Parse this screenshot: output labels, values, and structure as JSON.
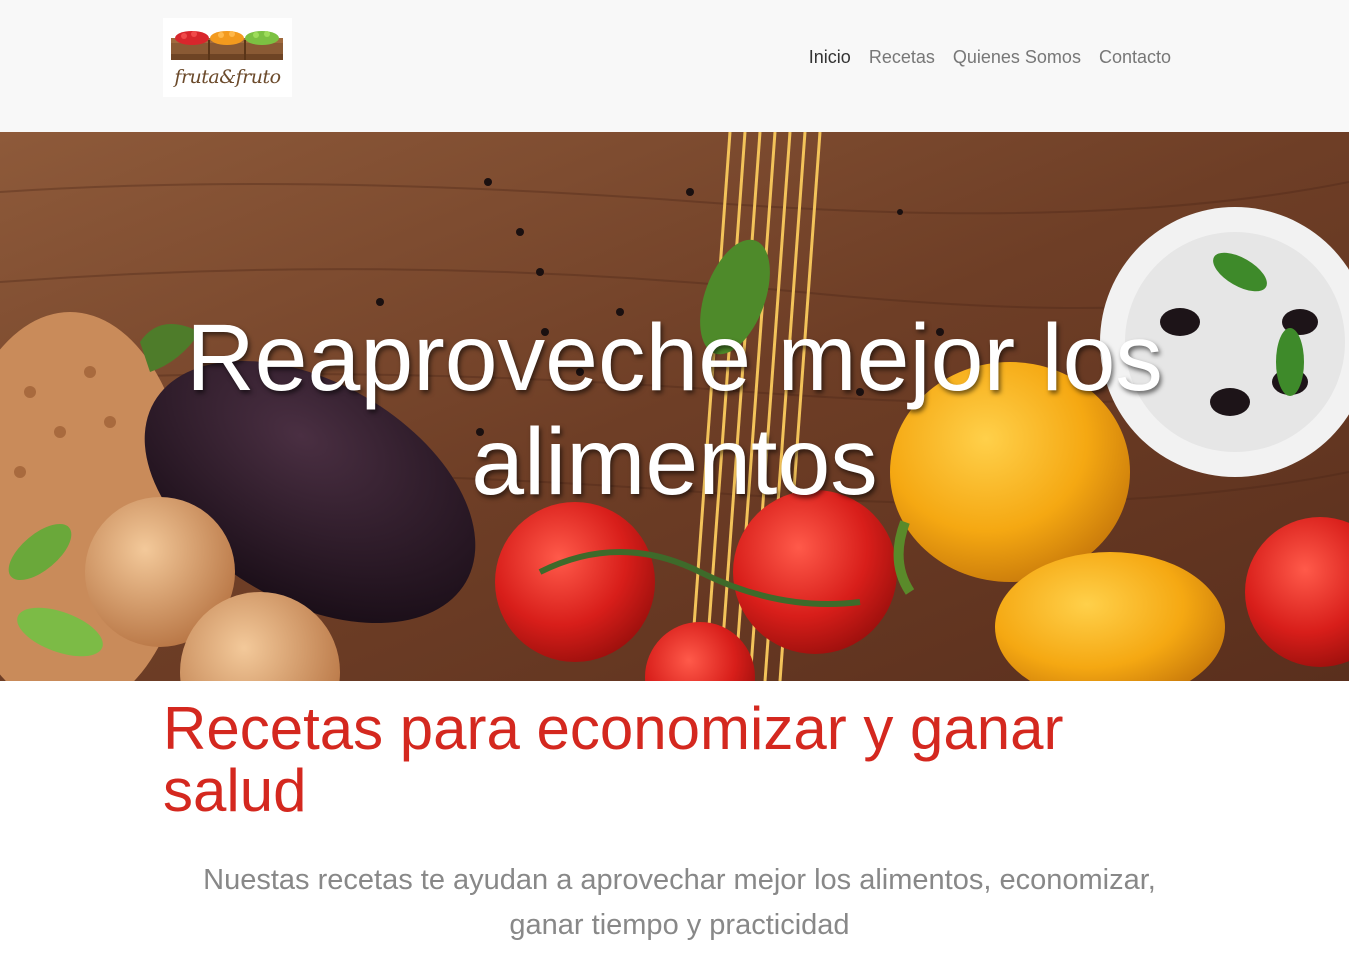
{
  "brand": {
    "name": "fruta&fruto"
  },
  "nav": {
    "items": [
      {
        "label": "Inicio"
      },
      {
        "label": "Recetas"
      },
      {
        "label": "Quienes Somos"
      },
      {
        "label": "Contacto"
      }
    ]
  },
  "hero": {
    "title": "Reaproveche mejor los alimentos"
  },
  "main": {
    "heading": "Recetas para economizar y ganar salud",
    "lead": "Nuestas recetas te ayudan a aprovechar mejor los alimentos, economizar, ganar tiempo y practicidad"
  },
  "colors": {
    "navbar_bg": "#f8f8f8",
    "nav_active": "#333333",
    "nav_link": "#777777",
    "heading": "#d4281f",
    "lead_text": "#888888"
  }
}
